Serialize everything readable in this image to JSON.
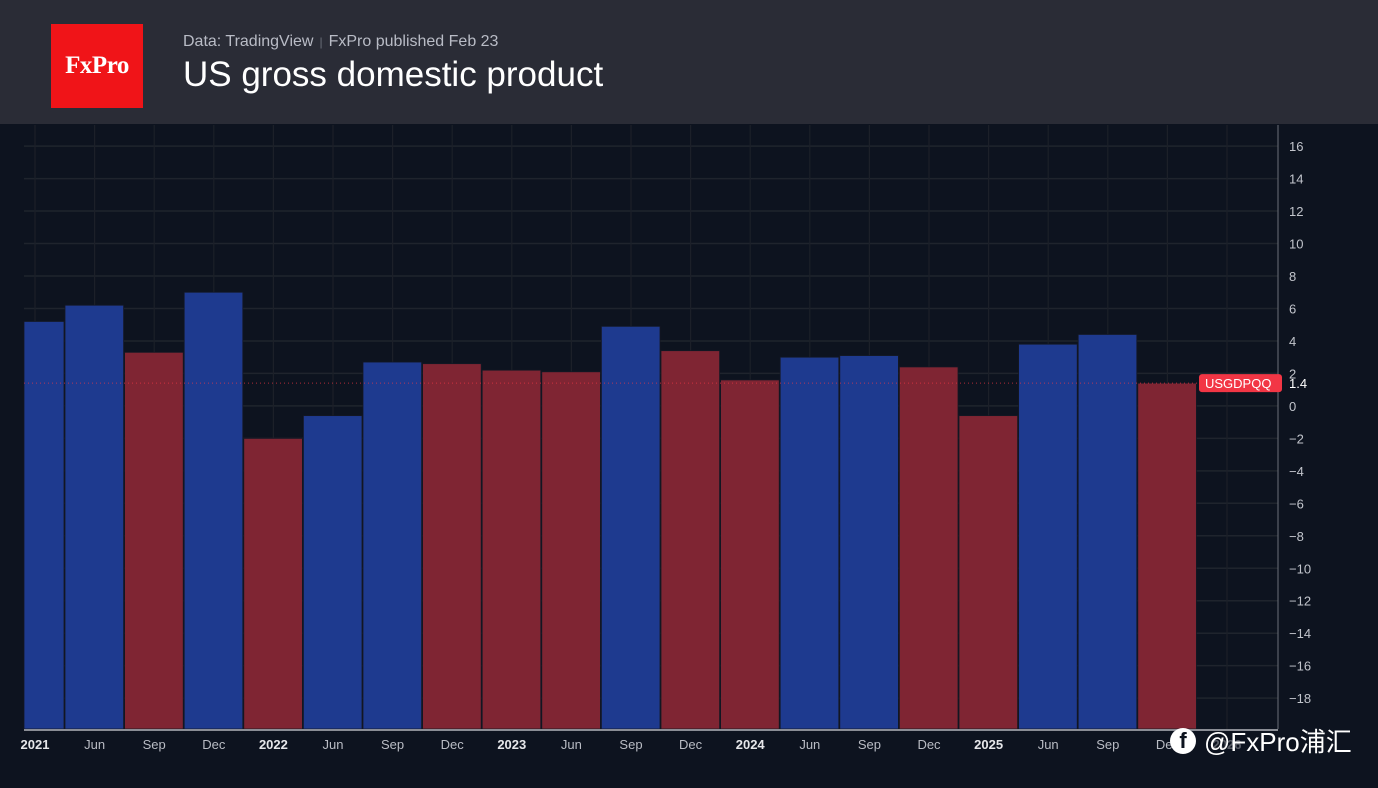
{
  "header": {
    "logo_text": "FxPro",
    "source": "Data: TradingView",
    "published": "FxPro published Feb 23",
    "title": "US gross domestic product"
  },
  "watermark": {
    "icon": "facebook-icon",
    "text": "@FxPro浦汇"
  },
  "chart_data": {
    "type": "bar",
    "title": "US gross domestic product",
    "symbol": "USGDPQQ",
    "last_value": "1.4",
    "categories": [
      "Mar 2021",
      "Jun 2021",
      "Sep 2021",
      "Dec 2021",
      "Mar 2022",
      "Jun 2022",
      "Sep 2022",
      "Dec 2022",
      "Mar 2023",
      "Jun 2023",
      "Sep 2023",
      "Dec 2023",
      "Mar 2024",
      "Jun 2024",
      "Sep 2024",
      "Dec 2024",
      "Mar 2025",
      "Jun 2025",
      "Sep 2025",
      "Dec 2025"
    ],
    "values": [
      5.2,
      6.2,
      3.3,
      7.0,
      -2.0,
      -0.6,
      2.7,
      2.6,
      2.2,
      2.1,
      4.9,
      3.4,
      1.6,
      3.0,
      3.1,
      2.4,
      -0.6,
      3.8,
      4.4,
      1.4
    ],
    "x_tick_labels": [
      "2021",
      "Jun",
      "Sep",
      "Dec",
      "2022",
      "Jun",
      "Sep",
      "Dec",
      "2023",
      "Jun",
      "Sep",
      "Dec",
      "2024",
      "Jun",
      "Sep",
      "Dec",
      "2025",
      "Jun",
      "Sep",
      "Dec",
      "2026"
    ],
    "y_ticks": [
      16,
      14,
      12,
      10,
      8,
      6,
      4,
      2,
      0,
      -2,
      -4,
      -6,
      -8,
      -10,
      -12,
      -14,
      -16,
      -18
    ],
    "ylim": [
      -19.9,
      17.3
    ],
    "grid": true,
    "colors": {
      "up": "#1e3a8f",
      "down": "#7f2533",
      "label": "#f23645",
      "background": "#0d131f"
    }
  }
}
